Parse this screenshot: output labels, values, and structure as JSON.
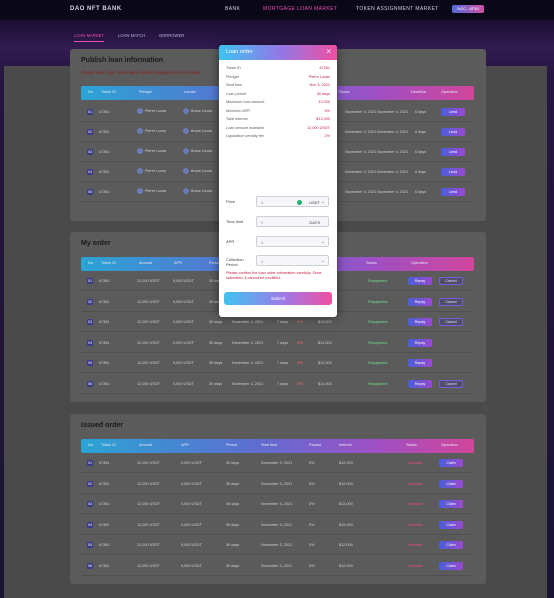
{
  "nav": {
    "brand": "DAO NFT BANK",
    "items": [
      "BANK",
      "MORTGAGE LOAN MARKET",
      "TOKEN ASSIGNMENT MARKET"
    ],
    "wallet_button": "0x2C...6F3D"
  },
  "subtabs": [
    "LOAN MARKET",
    "LOAN MATCH",
    "BORROWER"
  ],
  "publish": {
    "title": "Publish loan information",
    "note": "Please note: loan information will be displayed in the market.",
    "columns": [
      "No.",
      "Token ID",
      "Pledger",
      "Lender",
      "Amount",
      "APR",
      "Period",
      "Start time",
      "Deadline",
      "Status",
      "Operation"
    ],
    "rows": [
      {
        "no": "01",
        "token": "#7361",
        "pledger": "Pierre Lucas",
        "lender": "Bruce Lucas",
        "start": "November 3, 2021",
        "deadline": "November 4, 2021",
        "status": "6 days",
        "action": "Lend"
      },
      {
        "no": "02",
        "token": "#7361",
        "pledger": "Pierre Lucas",
        "lender": "Bruce Lucas",
        "start": "November 3, 2021",
        "deadline": "November 4, 2021",
        "status": "6 days",
        "action": "Lend"
      },
      {
        "no": "03",
        "token": "#7361",
        "pledger": "Pierre Lucas",
        "lender": "Bruce Lucas",
        "start": "November 3, 2021",
        "deadline": "November 4, 2021",
        "status": "6 days",
        "action": "Lend"
      },
      {
        "no": "04",
        "token": "#7361",
        "pledger": "Pierre Lucas",
        "lender": "Bruce Lucas",
        "start": "November 3, 2021",
        "deadline": "November 4, 2021",
        "status": "6 days",
        "action": "Lend"
      },
      {
        "no": "05",
        "token": "#7361",
        "pledger": "Pierre Lucas",
        "lender": "Bruce Lucas",
        "start": "November 3, 2021",
        "deadline": "November 4, 2021",
        "status": "6 days",
        "action": "Lend"
      }
    ]
  },
  "my_order": {
    "title": "My order",
    "columns": [
      "No.",
      "Token ID",
      "Amount",
      "APR",
      "Period",
      "Start time",
      "Deadline",
      "Repaid",
      "Interest",
      "Status",
      "Operation"
    ],
    "rows": [
      {
        "no": "01",
        "token": "#7361",
        "amount": "12,000 USDT",
        "apr": "5,000 USDT",
        "period": "30 days",
        "start": "November 3, 2021",
        "deadline": "7 days",
        "repaid": "5%",
        "interest": "$12,000",
        "status": "Repayment",
        "b1": "Repay",
        "b2": "Cancel"
      },
      {
        "no": "02",
        "token": "#7361",
        "amount": "12,000 USDT",
        "apr": "5,000 USDT",
        "period": "30 days",
        "start": "November 3, 2021",
        "deadline": "7 days",
        "repaid": "5%",
        "interest": "$12,000",
        "status": "Repayment",
        "b1": "Repay",
        "b2": "Cancel"
      },
      {
        "no": "03",
        "token": "#7361",
        "amount": "12,000 USDT",
        "apr": "5,000 USDT",
        "period": "30 days",
        "start": "November 3, 2021",
        "deadline": "7 days",
        "repaid": "5%",
        "interest": "$12,000",
        "status": "Repayment",
        "b1": "Repay",
        "b2": "Cancel"
      },
      {
        "no": "04",
        "token": "#7361",
        "amount": "12,000 USDT",
        "apr": "5,000 USDT",
        "period": "30 days",
        "start": "November 3, 2021",
        "deadline": "7 days",
        "repaid": "5%",
        "interest": "$12,000",
        "status": "Repayment",
        "b1": "Repay",
        "b2": ""
      },
      {
        "no": "05",
        "token": "#7361",
        "amount": "12,000 USDT",
        "apr": "5,000 USDT",
        "period": "30 days",
        "start": "November 3, 2021",
        "deadline": "7 days",
        "repaid": "5%",
        "interest": "$12,000",
        "status": "Repayment",
        "b1": "Repay",
        "b2": ""
      },
      {
        "no": "06",
        "token": "#7361",
        "amount": "12,000 USDT",
        "apr": "5,000 USDT",
        "period": "30 days",
        "start": "November 3, 2021",
        "deadline": "7 days",
        "repaid": "5%",
        "interest": "$12,000",
        "status": "Repayment",
        "b1": "Repay",
        "b2": "Cancel"
      }
    ]
  },
  "issued": {
    "title": "Issued order",
    "columns": [
      "No.",
      "Token ID",
      "Amount",
      "APR",
      "Period",
      "Start time",
      "Repaid",
      "Interest",
      "Status",
      "Operation"
    ],
    "rows": [
      {
        "no": "01",
        "token": "#7361",
        "amount": "12,000 USDT",
        "apr": "5,000 USDT",
        "period": "30 days",
        "start": "November 3, 2021",
        "repaid": "5%",
        "interest": "$12,000",
        "status": "Overdue",
        "action": "Claim"
      },
      {
        "no": "02",
        "token": "#7361",
        "amount": "12,000 USDT",
        "apr": "5,000 USDT",
        "period": "30 days",
        "start": "November 3, 2021",
        "repaid": "5%",
        "interest": "$12,000",
        "status": "Overdue",
        "action": "Claim"
      },
      {
        "no": "03",
        "token": "#7361",
        "amount": "12,000 USDT",
        "apr": "5,000 USDT",
        "period": "30 days",
        "start": "November 3, 2021",
        "repaid": "5%",
        "interest": "$12,000",
        "status": "Overdue",
        "action": "Claim"
      },
      {
        "no": "04",
        "token": "#7361",
        "amount": "12,000 USDT",
        "apr": "5,000 USDT",
        "period": "30 days",
        "start": "November 3, 2021",
        "repaid": "5%",
        "interest": "$12,000",
        "status": "Overdue",
        "action": "Claim"
      },
      {
        "no": "05",
        "token": "#7361",
        "amount": "12,000 USDT",
        "apr": "5,000 USDT",
        "period": "30 days",
        "start": "November 3, 2021",
        "repaid": "5%",
        "interest": "$12,000",
        "status": "Overdue",
        "action": "Claim"
      },
      {
        "no": "06",
        "token": "#7361",
        "amount": "12,000 USDT",
        "apr": "5,000 USDT",
        "period": "30 days",
        "start": "November 3, 2021",
        "repaid": "5%",
        "interest": "$12,000",
        "status": "Overdue",
        "action": "Claim"
      }
    ]
  },
  "modal": {
    "title": "Loan order",
    "close": "×",
    "info": [
      {
        "label": "Token ID",
        "value": "#7361"
      },
      {
        "label": "Pledger",
        "value": "Pierre Lucas"
      },
      {
        "label": "Start time",
        "value": "Nov 3, 2021"
      },
      {
        "label": "Loan period",
        "value": "30 days"
      },
      {
        "label": "Maximum loan amount",
        "value": "12,000"
      },
      {
        "label": "Minimum APR",
        "value": "5%"
      },
      {
        "label": "Total interest",
        "value": "$12,000"
      },
      {
        "label": "Loan amount available",
        "value": "12,000 USDT"
      },
      {
        "label": "Liquidation penalty fee",
        "value": "2%"
      }
    ],
    "fields": {
      "amount_label": "Price",
      "amount_placeholder": "0",
      "amount_unit": "USDT",
      "period_label": "Time limit",
      "period_placeholder": "0",
      "period_unit": "DAYS",
      "apr_label": "APR",
      "apr_placeholder": "0",
      "cycle_label": "Collection Period",
      "cycle_placeholder": "0"
    },
    "note": "Please confirm the loan order information carefully. Once submitted, it cannot be modified.",
    "submit": "Submit"
  },
  "colors": {
    "accent_pink": "#ec4fb0",
    "accent_blue": "#3ec4f0",
    "status_red": "#ff4a7a",
    "status_green": "#6fe08a"
  }
}
